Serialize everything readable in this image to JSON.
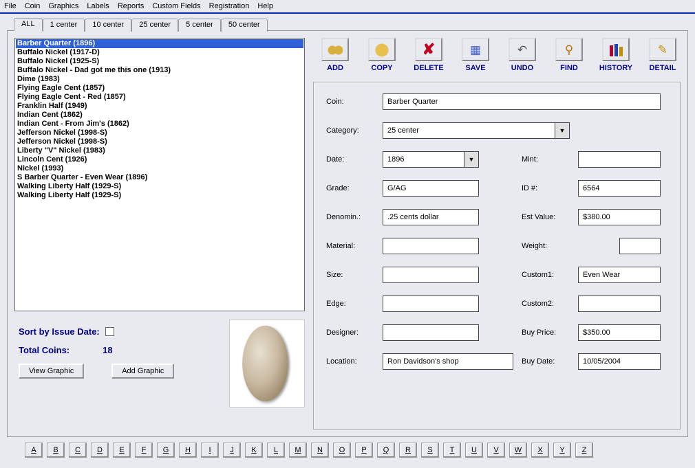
{
  "menu": [
    "File",
    "Coin",
    "Graphics",
    "Labels",
    "Reports",
    "Custom Fields",
    "Registration",
    "Help"
  ],
  "tabs": [
    "ALL",
    "1 center",
    "10 center",
    "25 center",
    "5 center",
    "50 center"
  ],
  "active_tab": 0,
  "list": [
    "Barber Quarter (1896)",
    "Buffalo Nickel (1917-D)",
    "Buffalo Nickel (1925-S)",
    "Buffalo Nickel - Dad got me this one (1913)",
    "Dime (1983)",
    "Flying Eagle Cent (1857)",
    "Flying Eagle Cent - Red (1857)",
    "Franklin Half (1949)",
    "Indian Cent (1862)",
    "Indian Cent - From Jim's (1862)",
    "Jefferson Nickel (1998-S)",
    "Jefferson Nickel (1998-S)",
    "Liberty \"V\" Nickel (1983)",
    "Lincoln Cent (1926)",
    "Nickel (1993)",
    "S Barber Quarter - Even Wear (1896)",
    "Walking Liberty Half (1929-S)",
    "Walking Liberty Half (1929-S)"
  ],
  "selected_index": 0,
  "sort_label": "Sort by Issue Date:",
  "total_label": "Total Coins:",
  "total_value": "18",
  "btn_view_graphic": "View Graphic",
  "btn_add_graphic": "Add Graphic",
  "toolbar": [
    {
      "key": "add",
      "label": "ADD",
      "icon": "ico-add"
    },
    {
      "key": "copy",
      "label": "COPY",
      "icon": "ico-copy"
    },
    {
      "key": "delete",
      "label": "DELETE",
      "icon": "ico-del",
      "glyph": "✘"
    },
    {
      "key": "save",
      "label": "SAVE",
      "icon": "ico-save",
      "glyph": "▦"
    },
    {
      "key": "undo",
      "label": "UNDO",
      "icon": "ico-undo",
      "glyph": "↶"
    },
    {
      "key": "find",
      "label": "FIND",
      "icon": "ico-find",
      "glyph": "⚲"
    },
    {
      "key": "history",
      "label": "HISTORY",
      "icon": "ico-hist"
    },
    {
      "key": "detail",
      "label": "DETAIL",
      "icon": "ico-det",
      "glyph": "✎"
    }
  ],
  "fields": {
    "coin_l": "Coin:",
    "coin_v": "Barber Quarter",
    "category_l": "Category:",
    "category_v": "25 center",
    "date_l": "Date:",
    "date_v": "1896",
    "mint_l": "Mint:",
    "mint_v": "",
    "grade_l": "Grade:",
    "grade_v": "G/AG",
    "id_l": "ID #:",
    "id_v": "6564",
    "denom_l": "Denomin.:",
    "denom_v": ".25 cents dollar",
    "est_l": "Est Value:",
    "est_v": "$380.00",
    "material_l": "Material:",
    "material_v": "",
    "weight_l": "Weight:",
    "weight_v": "",
    "size_l": "Size:",
    "size_v": "",
    "custom1_l": "Custom1:",
    "custom1_v": "Even Wear",
    "edge_l": "Edge:",
    "edge_v": "",
    "custom2_l": "Custom2:",
    "custom2_v": "",
    "designer_l": "Designer:",
    "designer_v": "",
    "buyprice_l": "Buy Price:",
    "buyprice_v": "$350.00",
    "location_l": "Location:",
    "location_v": "Ron Davidson's shop",
    "buydate_l": "Buy Date:",
    "buydate_v": "10/05/2004"
  },
  "alpha": [
    "A",
    "B",
    "C",
    "D",
    "E",
    "F",
    "G",
    "H",
    "I",
    "J",
    "K",
    "L",
    "M",
    "N",
    "O",
    "P",
    "Q",
    "R",
    "S",
    "T",
    "U",
    "V",
    "W",
    "X",
    "Y",
    "Z"
  ]
}
